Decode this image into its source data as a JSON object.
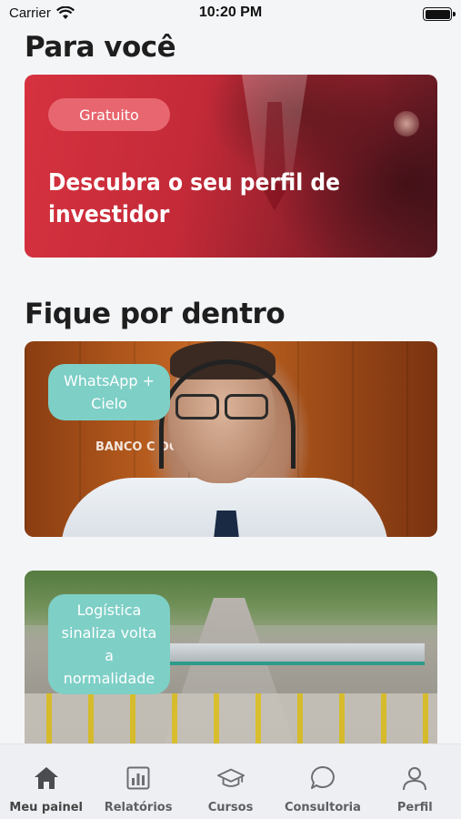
{
  "status": {
    "carrier": "Carrier",
    "time": "10:20 PM",
    "battery_level": 1.0
  },
  "sections": {
    "for_you_title": "Para você",
    "stay_informed_title": "Fique por dentro"
  },
  "promo": {
    "badge": "Gratuito",
    "title": "Descubra o seu perfil de investidor"
  },
  "news": [
    {
      "tag": "WhatsApp + Cielo",
      "image_text": "BANCO C  DO BRA"
    },
    {
      "tag": "Logística sinaliza volta a normalidade"
    }
  ],
  "tabs": [
    {
      "label": "Meu painel",
      "icon": "home-icon",
      "active": true
    },
    {
      "label": "Relatórios",
      "icon": "bar-chart-icon"
    },
    {
      "label": "Cursos",
      "icon": "graduation-cap-icon"
    },
    {
      "label": "Consultoria",
      "icon": "chat-bubble-icon"
    },
    {
      "label": "Perfil",
      "icon": "user-icon"
    }
  ],
  "colors": {
    "accent_red": "#d6323f",
    "tag_teal": "#7ecfc6",
    "badge_pink": "#e8666f"
  }
}
